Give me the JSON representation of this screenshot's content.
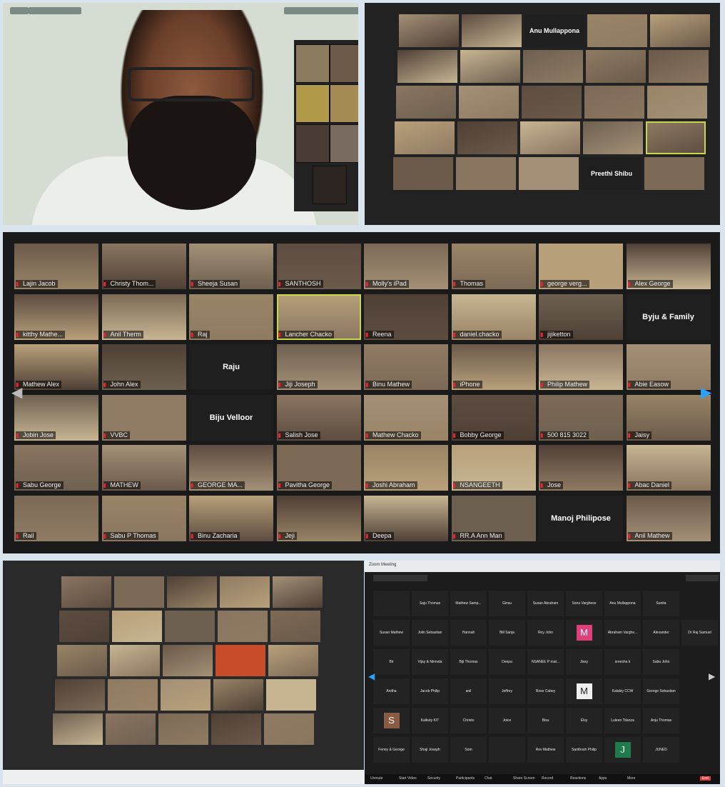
{
  "panel1": {
    "chips": [
      "",
      "",
      "",
      ""
    ]
  },
  "panel2": {
    "text_tiles": [
      "Anu Mullappona",
      "Preethi Shibu"
    ]
  },
  "panel3": {
    "tiles": [
      [
        "Lajin Jacob",
        "Christy Thom...",
        "Sheeja Susan",
        "SANTHOSH",
        "Molly's iPad",
        "Thomas",
        "george verg...",
        "Alex George"
      ],
      [
        "kitthy Mathe...",
        "Anil Therm",
        "Raj",
        "Lancher Chacko",
        "Reena",
        "daniel.chacko",
        "jijiketton",
        "Byju & Family"
      ],
      [
        "Mathew Alex",
        "John Alex",
        "Raju",
        "Jiji Joseph",
        "Binu Mathew",
        "iPhone",
        "Philip Mathew",
        "Abie Easow"
      ],
      [
        "Jobin Jose",
        "VVBC",
        "Biju Velloor",
        "Salish Jose",
        "Mathew Chacko",
        "Bobby George",
        "500 815 3022",
        "Jaisy"
      ],
      [
        "Sabu George",
        "MATHEW",
        "GEORGE MA...",
        "Pavitha George",
        "Joshi Abraham",
        "NSANGEETH",
        "Jose",
        "Abac Daniel"
      ],
      [
        "Rail",
        "Sabu P Thomas",
        "Binu Zacharia",
        "Jeji",
        "Deepa",
        "RR.A Ann Man",
        "Manoj Philipose",
        "Anil Mathew"
      ]
    ],
    "text_tiles": [
      "Byju & Family",
      "Raju",
      "Biju Velloor",
      "Manoj Philipose"
    ]
  },
  "panel5": {
    "rows": [
      [
        "",
        "Saju Thomas",
        "Mathew Samp...",
        "Ginsu",
        "Susan Abraham",
        "Sonu Varghese",
        "Anu Mullappona",
        "Sunita"
      ],
      [
        "Susan Mathew",
        "Jolin Sebastian",
        "Hannah",
        "Bill Sanja",
        "Roy John",
        "M",
        "Abraham Varghe...",
        "Alexander",
        "Dr Raj Samuel"
      ],
      [
        "Bir",
        "Vijay & Nirmala",
        "Biji Thomas",
        "Deepa",
        "NSANEE P mat...",
        "Jissy",
        "sreesha k",
        "Sabu John"
      ],
      [
        "Anitha",
        "Jacob Philip",
        "anil",
        "Jeffrey",
        "Rose Cabey",
        "M",
        "Kalakty CCW",
        "George Sebastian"
      ],
      [
        "S",
        "Kalkuty KIT",
        "Christo",
        "Joice",
        "Bisu",
        "Elsy",
        "Luleen Titanza",
        "Anju Thomas"
      ],
      [
        "Fenny & George",
        "Shaji Joseph",
        "Som",
        "",
        "Rev Mathew",
        "Santhosh Philip",
        "J",
        "JUNED"
      ]
    ],
    "avatar_letters": [
      "M",
      "S",
      "J"
    ],
    "toolbar_items": [
      "Unmute",
      "Start Video",
      "Security",
      "Participants",
      "Chat",
      "Share Screen",
      "Record",
      "Reactions",
      "Apps",
      "More",
      "End"
    ],
    "meeting_title": "Zoom Meeting"
  },
  "colors": {
    "zoom_blue": "#2aa0ff",
    "active_speaker": "#c8d64a",
    "end_red": "#e23b3b",
    "avatar_pink": "#e0407a",
    "avatar_brown": "#8a5a42",
    "avatar_green": "#1f7a4c"
  }
}
